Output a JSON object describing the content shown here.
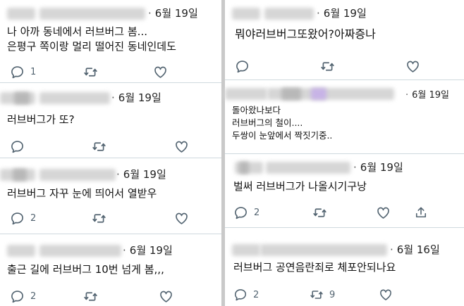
{
  "tweets_left": [
    {
      "date": "6월 19일",
      "lines": [
        "나 아까 동네에서 러브버그 봄...",
        "은평구 쪽이랑 멀리 떨어진 동네인데도"
      ],
      "replies": "1",
      "retweets": "",
      "likes": ""
    },
    {
      "date": "6월 19일",
      "lines": [
        "러브버그가 또?"
      ],
      "replies": "",
      "retweets": "",
      "likes": ""
    },
    {
      "date": "6월 19일",
      "lines": [
        "러브버그 자꾸 눈에 띄어서 열받우"
      ],
      "replies": "2",
      "retweets": "",
      "likes": ""
    },
    {
      "date": "6월 19일",
      "lines": [
        "출근 길에 러브버그 10번 넘게 봄,,,"
      ],
      "replies": "2",
      "retweets": "",
      "likes": ""
    }
  ],
  "tweets_right": [
    {
      "date": "6월 19일",
      "lines": [
        "뭐야러브버그또왔어?아짜증나"
      ],
      "replies": "",
      "retweets": "",
      "likes": ""
    },
    {
      "date": "6월 19일",
      "lines": [
        "돌아왔나보다",
        "러브버그의 철이....",
        "두쌍이 눈앞에서 짝짓기중.."
      ],
      "replies": "",
      "retweets": "",
      "likes": ""
    },
    {
      "date": "6월 19일",
      "lines": [
        "벌써 러브버그가 나올시기구낭"
      ],
      "replies": "2",
      "retweets": "",
      "likes": ""
    },
    {
      "date": "6월 16일",
      "lines": [
        "러브버그 공연음란죄로 체포안되나요"
      ],
      "replies": "2",
      "retweets": "9",
      "likes": ""
    }
  ],
  "icons": [
    "reply-icon",
    "retweet-icon",
    "like-icon",
    "share-icon"
  ],
  "colors": {
    "text": "#0f1419",
    "muted": "#536471",
    "divider": "#c9c9c9",
    "rule": "#cfd9de"
  }
}
